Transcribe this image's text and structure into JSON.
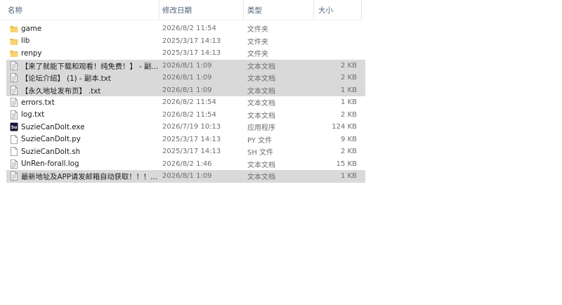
{
  "columns": {
    "name": "名称",
    "date": "修改日期",
    "type": "类型",
    "size": "大小"
  },
  "colors": {
    "folder": "#f2c55c",
    "selection": "#d9d9d9",
    "header_text": "#4c607a"
  },
  "files": [
    {
      "name": "game",
      "date": "2026/8/2 11:54",
      "type": "文件夹",
      "size": "",
      "icon": "folder-icon",
      "selected": false
    },
    {
      "name": "lib",
      "date": "2025/3/17 14:13",
      "type": "文件夹",
      "size": "",
      "icon": "folder-icon",
      "selected": false
    },
    {
      "name": "renpy",
      "date": "2025/3/17 14:13",
      "type": "文件夹",
      "size": "",
      "icon": "folder-icon",
      "selected": false
    },
    {
      "name": "【来了就能下载和观看！纯免费！】 - 副...",
      "date": "2026/8/1 1:09",
      "type": "文本文档",
      "size": "2 KB",
      "icon": "text-file-icon",
      "selected": true
    },
    {
      "name": "【论坛介绍】 (1) - 副本.txt",
      "date": "2026/8/1 1:09",
      "type": "文本文档",
      "size": "2 KB",
      "icon": "text-file-icon",
      "selected": true
    },
    {
      "name": "【永久地址发布页】 .txt",
      "date": "2026/8/1 1:09",
      "type": "文本文档",
      "size": "1 KB",
      "icon": "text-file-icon",
      "selected": true
    },
    {
      "name": "errors.txt",
      "date": "2026/8/2 11:54",
      "type": "文本文档",
      "size": "1 KB",
      "icon": "text-file-icon",
      "selected": false
    },
    {
      "name": "log.txt",
      "date": "2026/8/2 11:54",
      "type": "文本文档",
      "size": "2 KB",
      "icon": "text-file-icon",
      "selected": false
    },
    {
      "name": "SuzieCanDoIt.exe",
      "date": "2026/7/19 10:13",
      "type": "应用程序",
      "size": "124 KB",
      "icon": "app-icon",
      "icon_text": "Su",
      "selected": false
    },
    {
      "name": "SuzieCanDoIt.py",
      "date": "2025/3/17 14:13",
      "type": "PY 文件",
      "size": "9 KB",
      "icon": "blank-file-icon",
      "selected": false
    },
    {
      "name": "SuzieCanDoIt.sh",
      "date": "2025/3/17 14:13",
      "type": "SH 文件",
      "size": "2 KB",
      "icon": "blank-file-icon",
      "selected": false
    },
    {
      "name": "UnRen-forall.log",
      "date": "2026/8/2 1:46",
      "type": "文本文档",
      "size": "15 KB",
      "icon": "text-file-icon",
      "selected": false
    },
    {
      "name": "最新地址及APP请发邮箱自动获取！！！...",
      "date": "2026/8/1 1:09",
      "type": "文本文档",
      "size": "1 KB",
      "icon": "text-file-icon",
      "selected": true
    }
  ]
}
